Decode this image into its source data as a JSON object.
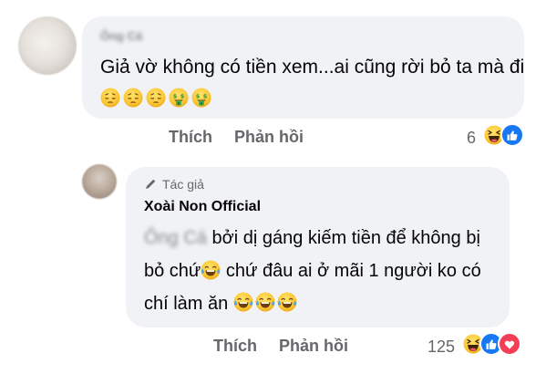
{
  "comment1": {
    "author": "Ông Cá",
    "text": "Giả vờ không có tiền xem...ai cũng rời bỏ ta mà đi",
    "emojis": [
      "pensive-face",
      "pensive-face",
      "pensive-face",
      "money-mouth-face",
      "money-mouth-face"
    ],
    "actions": {
      "like": "Thích",
      "reply": "Phản hồi"
    },
    "reaction_count": "6",
    "reactions": [
      "haha",
      "like"
    ]
  },
  "comment2": {
    "badge": "Tác giả",
    "author": "Xoài Non Official",
    "mention": "Ông Cá",
    "text_line1": "bởi dị gáng kiếm tiền để không bị",
    "text_line2a": "bỏ chứ",
    "text_line2b": "chứ đâu ai ở mãi 1 người ko có",
    "text_line3": "chí làm ăn",
    "emojis_end": [
      "tears-of-joy",
      "tears-of-joy",
      "tears-of-joy"
    ],
    "actions": {
      "like": "Thích",
      "reply": "Phản hồi"
    },
    "reaction_count": "125",
    "reactions": [
      "haha",
      "like",
      "love"
    ]
  },
  "colors": {
    "bubble": "#f0f2f5",
    "secondary_text": "#65676b",
    "like_blue": "#1877f2",
    "love_red": "#f33e58"
  }
}
